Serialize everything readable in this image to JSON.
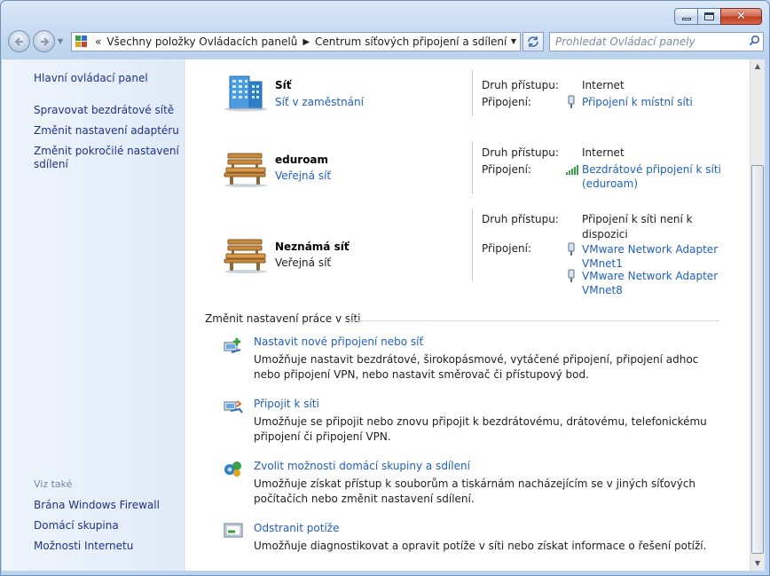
{
  "window": {
    "caption_buttons": {
      "minimize": "minimize-icon",
      "maximize": "maximize-icon",
      "close": "close-icon",
      "close_glyph": "✕"
    }
  },
  "nav": {
    "back_icon": "back-arrow-icon",
    "forward_icon": "forward-arrow-icon",
    "address": {
      "overflow_chevron": "«",
      "crumbs": [
        "Všechny položky Ovládacích panelů",
        "Centrum síťových připojení a sdílení"
      ],
      "separator": "▶"
    },
    "refresh_icon": "refresh-icon",
    "search": {
      "placeholder": "Prohledat Ovládací panely",
      "value": ""
    }
  },
  "sidebar": {
    "home": "Hlavní ovládací panel",
    "tasks": [
      "Spravovat bezdrátové sítě",
      "Změnit nastavení adaptéru",
      "Změnit pokročilé nastavení sdílení"
    ],
    "see_also_title": "Viz také",
    "see_also": [
      "Brána Windows Firewall",
      "Domácí skupina",
      "Možnosti Internetu"
    ]
  },
  "networks": [
    {
      "name": "Síť",
      "type": "Síť v zaměstnání",
      "type_is_link": true,
      "icon": "office-building-icon",
      "access_label": "Druh přístupu:",
      "access_value": "Internet",
      "connection_label": "Připojení:",
      "connection": "Připojení k místní síti",
      "connection_icon": "ethernet-icon"
    },
    {
      "name": "eduroam",
      "type": "Veřejná síť",
      "type_is_link": true,
      "icon": "park-bench-icon",
      "access_label": "Druh přístupu:",
      "access_value": "Internet",
      "connection_label": "Připojení:",
      "connection": "Bezdrátové připojení k síti (eduroam)",
      "connection_icon": "wifi-signal-icon"
    },
    {
      "name": "Neznámá síť",
      "type": "Veřejná síť",
      "type_is_link": false,
      "icon": "park-bench-icon",
      "access_label": "Druh přístupu:",
      "access_value": "Připojení k síti není k dispozici",
      "connection_label": "Připojení:",
      "connections": [
        "VMware Network Adapter VMnet1",
        "VMware Network Adapter VMnet8"
      ],
      "connection_icon": "ethernet-icon"
    }
  ],
  "change_settings": {
    "title": "Změnit nastavení práce v síti",
    "tasks": [
      {
        "link": "Nastavit nové připojení nebo síť",
        "description": "Umožňuje nastavit bezdrátové, širokopásmové, vytáčené připojení, připojení adhoc nebo připojení VPN, nebo nastavit směrovač či přístupový bod.",
        "icon": "new-connection-icon"
      },
      {
        "link": "Připojit k síti",
        "description": "Umožňuje se připojit nebo znovu připojit k bezdrátovému, drátovému, telefonickému připojení či připojení VPN.",
        "icon": "connect-network-icon"
      },
      {
        "link": "Zvolit možnosti domácí skupiny a sdílení",
        "description": "Umožňuje získat přístup k souborům a tiskárnám nacházejícím se v jiných síťových počítačích nebo změnit nastavení sdílení.",
        "icon": "homegroup-icon"
      },
      {
        "link": "Odstranit potíže",
        "description": "Umožňuje diagnostikovat a opravit potíže v síti nebo získat informace o řešení potíží.",
        "icon": "troubleshoot-icon"
      }
    ]
  },
  "scrollbar": {
    "up_icon": "scroll-up-icon",
    "down_icon": "scroll-down-icon"
  }
}
